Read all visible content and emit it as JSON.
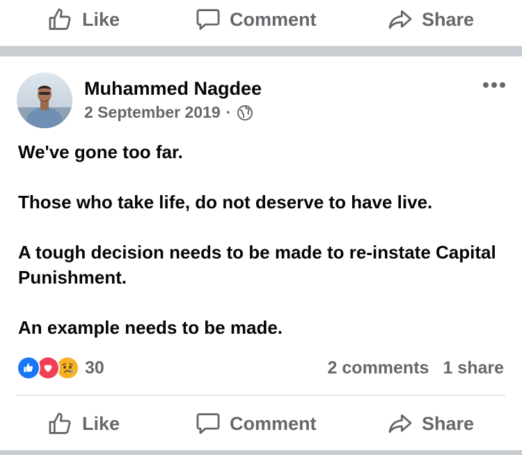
{
  "actions": {
    "like_label": "Like",
    "comment_label": "Comment",
    "share_label": "Share"
  },
  "post": {
    "author": "Muhammed Nagdee",
    "date": "2 September 2019",
    "separator": "·",
    "privacy_icon": "globe-icon",
    "paragraphs": [
      "We've gone too far.",
      "Those who take life, do not deserve to have live.",
      "A tough decision needs to be made to re-instate Capital Punishment.",
      "An example needs to be made."
    ]
  },
  "stats": {
    "reactions": [
      "like",
      "love",
      "sad"
    ],
    "reaction_count": "30",
    "comments": "2 comments",
    "shares": "1 share"
  },
  "colors": {
    "muted_text": "#65676b",
    "like_blue": "#1877f2",
    "love_red": "#f33e58",
    "sad_yellow": "#f7b125",
    "divider": "#c9ccd1"
  }
}
